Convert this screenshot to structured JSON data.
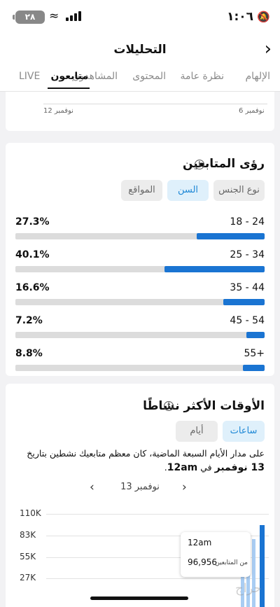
{
  "status": {
    "time": "١:٠٦",
    "battery": "٢٨"
  },
  "header": {
    "title": "التحليلات"
  },
  "tabs": [
    "الإلهام",
    "نظرة عامة",
    "المحتوى",
    "المشاهدون",
    "متابعون",
    "LIVE"
  ],
  "active_tab": "متابعون",
  "top_chart": {
    "x_left": "نوفمبر 12",
    "x_right": "نوفمبر 6"
  },
  "insights": {
    "title": "رؤى المتابعين",
    "filters": [
      "نوع الجنس",
      "السن",
      "المواقع"
    ],
    "active_filter": "السن",
    "rows": [
      {
        "range": "18 - 24",
        "percent": "27.3%",
        "value": 27.3
      },
      {
        "range": "25 - 34",
        "percent": "40.1%",
        "value": 40.1
      },
      {
        "range": "35 - 44",
        "percent": "16.6%",
        "value": 16.6
      },
      {
        "range": "45 - 54",
        "percent": "7.2%",
        "value": 7.2
      },
      {
        "range": "55+",
        "percent": "8.8%",
        "value": 8.8
      }
    ]
  },
  "active_times": {
    "title": "الأوقات الأكثر نشاطًا",
    "toggles": [
      "ساعات",
      "أيام"
    ],
    "active_toggle": "ساعات",
    "description_prefix": "على مدار الأيام السبعة الماضية، كان معظم متابعيك نشطين بتاريخ ",
    "description_date": "13 نوفمبر",
    "description_mid": " في ",
    "description_time": "12am",
    "description_suffix": ".",
    "date_label": "13 نوفمبر",
    "y_ticks": [
      "110K",
      "83K",
      "55K",
      "27K"
    ],
    "tooltip": {
      "time": "12am",
      "value": "96,956",
      "label": "من المتابعين"
    }
  },
  "chart_data": {
    "type": "bar",
    "title": "الأوقات الأكثر نشاطًا",
    "ylim": [
      0,
      110000
    ],
    "y_ticks": [
      "110K",
      "83K",
      "55K",
      "27K"
    ],
    "visible_bars": [
      {
        "x": "12am",
        "value": 96956,
        "highlighted": true
      }
    ]
  },
  "watermark": "حراج"
}
